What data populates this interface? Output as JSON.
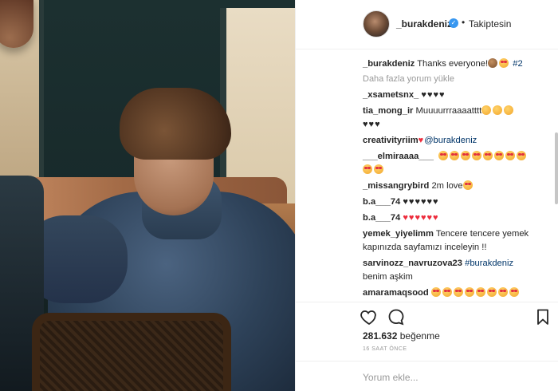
{
  "header": {
    "username": "_burakdeniz",
    "verified_mark": "✓",
    "separator": "•",
    "follow_label": "Takiptesin"
  },
  "comments_section": {
    "caption": {
      "username": "_burakdeniz",
      "text": "Thanks everyone!",
      "hashtag": "#2"
    },
    "load_more": "Daha fazla yorum yükle",
    "items": [
      {
        "username": "_xsametsnx_",
        "text": "♥♥♥♥"
      },
      {
        "username": "tia_mong_ir",
        "text": "Muuuurrraaaatttt",
        "text2": "♥♥♥"
      },
      {
        "username": "creativityriim",
        "mention": "@burakdeniz"
      },
      {
        "username": "___elmiraaaa___",
        "text": ""
      },
      {
        "username": "_missangrybird",
        "text": "2m love"
      },
      {
        "username": "b.a___74",
        "text": "♥♥♥♥♥♥"
      },
      {
        "username": "b.a___74",
        "text": "♥♥♥♥♥♥"
      },
      {
        "username": "yemek_yiyelimm",
        "text": "Tencere tencere yemek kapınızda sayfamızı inceleyin !!"
      },
      {
        "username": "sarvinozz_navruzova23",
        "hashtag": "#burakdeniz",
        "text": "benim aşkim"
      },
      {
        "username": "amaramaqsood",
        "text": ""
      }
    ]
  },
  "actions": {
    "like_icon": "heart-icon",
    "comment_icon": "comment-icon",
    "save_icon": "bookmark-icon"
  },
  "likes": {
    "count": "281.632",
    "label": "beğenme"
  },
  "timestamp": "16 SAAT ÖNCE",
  "add_comment": {
    "placeholder": "Yorum ekle..."
  },
  "colors": {
    "link": "#003569",
    "verified": "#3897f0",
    "heart_red": "#ed2c3c",
    "muted": "#999999"
  }
}
